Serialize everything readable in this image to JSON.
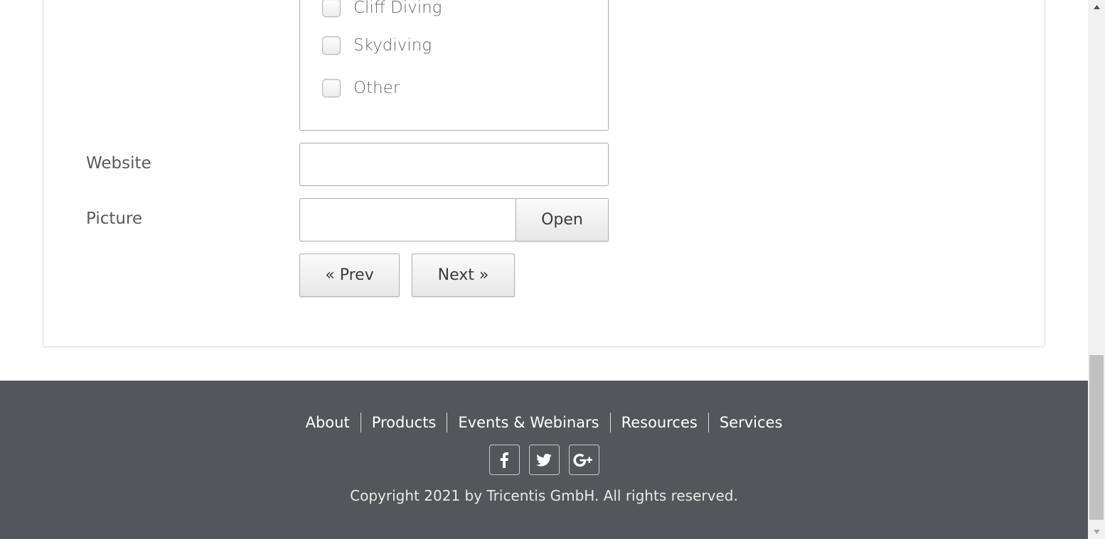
{
  "form": {
    "hobbies": [
      {
        "label": "Cliff Diving",
        "checked": false
      },
      {
        "label": "Skydiving",
        "checked": false
      },
      {
        "label": "Other",
        "checked": false
      }
    ],
    "website": {
      "label": "Website",
      "value": "",
      "placeholder": ""
    },
    "picture": {
      "label": "Picture",
      "value": "",
      "open_button": "Open"
    },
    "prev_button": "« Prev",
    "next_button": "Next »"
  },
  "footer": {
    "nav": [
      "About",
      "Products",
      "Events & Webinars",
      "Resources",
      "Services"
    ],
    "social": [
      {
        "name": "facebook",
        "glyph": "f"
      },
      {
        "name": "twitter",
        "glyph": ""
      },
      {
        "name": "google-plus",
        "glyph": "G+"
      }
    ],
    "copyright": "Copyright 2021 by Tricentis GmbH. All rights reserved."
  },
  "colors": {
    "footer_bg": "#53565a",
    "page_bg": "#ffffff"
  }
}
